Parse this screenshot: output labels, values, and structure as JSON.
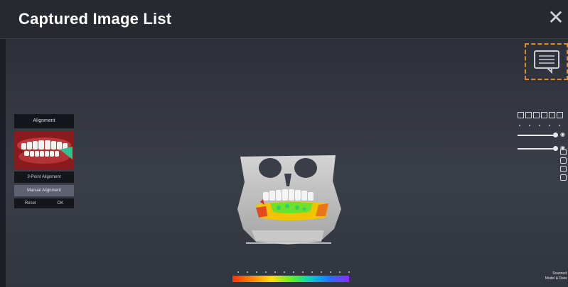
{
  "window": {
    "title": "Captured Image List",
    "close_symbol": "✕"
  },
  "left_panel": {
    "header_label": "Alignment",
    "buttons": [
      {
        "label": "3-Point Alignment"
      },
      {
        "label": "Manual Alignment"
      }
    ],
    "bottom_row": [
      "Reset",
      "OK"
    ]
  },
  "right_toolbar": {
    "icons": [
      "view-front-icon",
      "view-back-icon",
      "view-left-icon",
      "view-right-icon",
      "view-top-icon"
    ],
    "sliders": [
      {
        "end_icon": "eye-icon"
      },
      {
        "end_icon": "eye-icon"
      }
    ],
    "side_icons": [
      "rotate-icon",
      "move-icon",
      "zoom-icon",
      "reset-icon"
    ]
  },
  "colorbar": {
    "colors": [
      "#ff3300",
      "#ff8800",
      "#ffe000",
      "#66ee22",
      "#00d2c8",
      "#2c6cff",
      "#8c2cff"
    ]
  },
  "bottom_right_text": {
    "line1": "Scanned",
    "line2": "Model & Data"
  },
  "colors": {
    "accent_dashed": "#e08a2a",
    "background": "#1c1f26"
  }
}
